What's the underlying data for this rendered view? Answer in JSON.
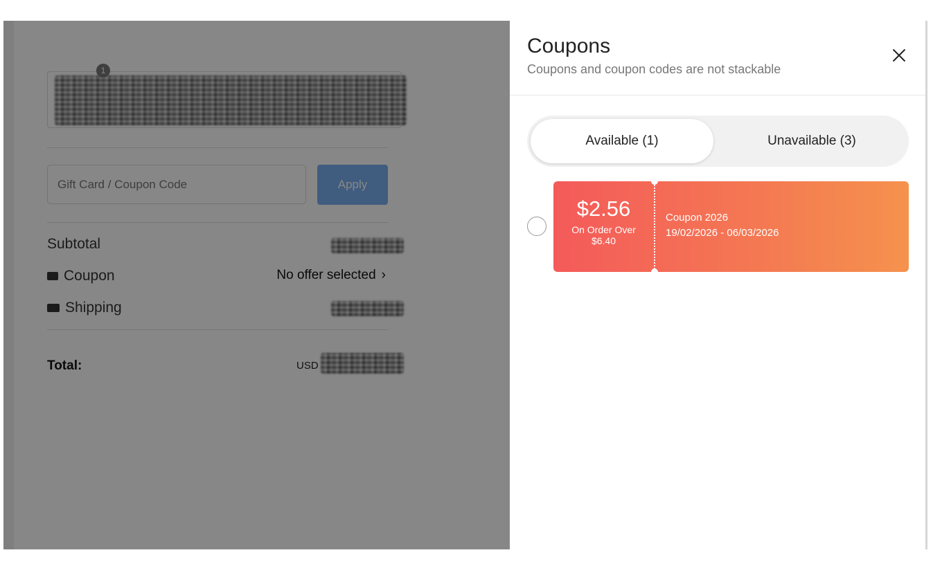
{
  "checkout": {
    "code_placeholder": "Gift Card / Coupon Code",
    "apply_label": "Apply",
    "product_badge": "1",
    "subtotal_label": "Subtotal",
    "coupon_label": "Coupon",
    "coupon_value": "No offer selected",
    "shipping_label": "Shipping",
    "total_label": "Total:",
    "currency": "USD"
  },
  "coupons_panel": {
    "title": "Coupons",
    "subtitle": "Coupons and coupon codes are not stackable",
    "tabs": [
      {
        "label": "Available (1)",
        "active": true
      },
      {
        "label": "Unavailable (3)",
        "active": false
      }
    ],
    "coupons": [
      {
        "amount": "$2.56",
        "condition_line1": "On Order Over",
        "condition_line2": "$6.40",
        "name": "Coupon 2026",
        "dates": "19/02/2026 - 06/03/2026",
        "selected": false
      }
    ]
  },
  "colors": {
    "coupon_start": "#f45a5a",
    "coupon_end": "#f5924d",
    "apply_button": "#7aaff0"
  },
  "icons": {
    "close": "close-icon",
    "coupon": "coupon-tag-icon",
    "shipping": "truck-icon",
    "chevron": "chevron-right-icon"
  }
}
